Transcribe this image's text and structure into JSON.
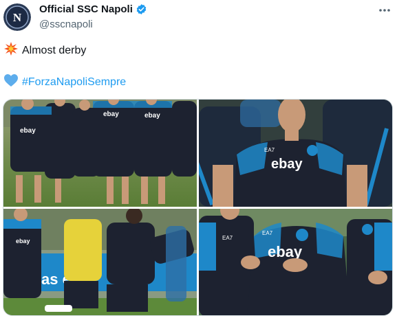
{
  "tweet": {
    "display_name": "Official SSC Napoli",
    "handle": "@sscnapoli",
    "verified_icon": "verified-badge-icon",
    "more_icon": "more-options-icon",
    "line1_emoji": "collision-emoji",
    "line1_text": "Almost derby",
    "line2_emoji": "blue-heart-emoji",
    "line2_hashtag": "#ForzaNapoliSempre",
    "avatar_letter": "N"
  },
  "media": {
    "jersey_sponsor": "ebay",
    "kit_brand": "EA7",
    "banner_text": "as e lu"
  },
  "colors": {
    "link": "#1d9bf0",
    "secondary_text": "#536471",
    "jersey": "#1d2230",
    "napoli_blue": "#1e88c9",
    "grass": "#5d8a3a"
  }
}
